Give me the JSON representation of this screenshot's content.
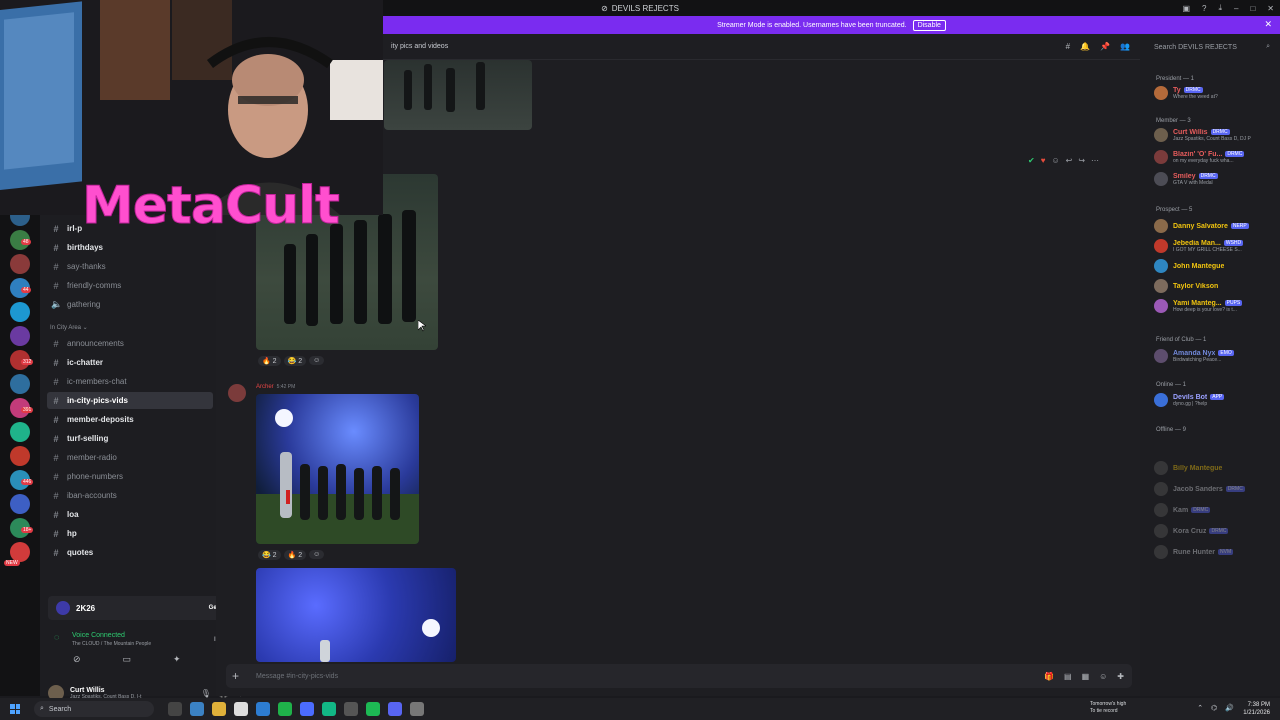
{
  "window": {
    "title": "DEVILS REJECTS"
  },
  "banner": {
    "message": "Streamer Mode is enabled. Usernames have been truncated.",
    "button": "Disable"
  },
  "rail_badges": [
    "48",
    "44",
    "312",
    "391",
    "446",
    "18+",
    "NEW"
  ],
  "sidebar": {
    "channels_top": [
      {
        "name": "irl-p",
        "bright": true
      },
      {
        "name": "birthdays",
        "bright": true
      },
      {
        "name": "say-thanks",
        "bright": false
      },
      {
        "name": "friendly-comms",
        "bright": false
      },
      {
        "name": "gathering",
        "bright": false
      }
    ],
    "category": "In City Area",
    "channels_city": [
      {
        "name": "announcements",
        "bright": false
      },
      {
        "name": "ic-chatter",
        "bright": true
      },
      {
        "name": "ic-members-chat",
        "bright": false
      },
      {
        "name": "in-city-pics-vids",
        "bright": true,
        "active": true
      },
      {
        "name": "member-deposits",
        "bright": true
      },
      {
        "name": "turf-selling",
        "bright": true
      },
      {
        "name": "member-radio",
        "bright": false
      },
      {
        "name": "phone-numbers",
        "bright": false
      },
      {
        "name": "iban-accounts",
        "bright": false
      },
      {
        "name": "loa",
        "bright": true
      },
      {
        "name": "hp",
        "bright": true
      },
      {
        "name": "quotes",
        "bright": true
      }
    ],
    "promo": {
      "logo": "2K26",
      "cta": "Get Reward"
    },
    "voice": {
      "status": "Voice Connected",
      "channel": "The CLOUD / The Mountain People"
    },
    "user": {
      "name": "Curt Willis",
      "status": "Jazz Spastiks, Count Bass D, I-t"
    }
  },
  "main": {
    "channel_partial": "ity pics and videos",
    "reactions_1": [
      {
        "emoji": "🔥",
        "count": "2"
      },
      {
        "emoji": "😂",
        "count": "2"
      }
    ],
    "message2": {
      "author": "Archer",
      "time": "5:42 PM"
    },
    "reactions_2": [
      {
        "emoji": "😂",
        "count": "2"
      },
      {
        "emoji": "🔥",
        "count": "2"
      }
    ],
    "composer_placeholder": "Message #in-city-pics-vids"
  },
  "members": {
    "search_placeholder": "Search DEVILS REJECTS",
    "groups": [
      {
        "header": "President — 1",
        "items": [
          {
            "name": "Ty",
            "tag": "DRMC",
            "color": "#e85d5d",
            "status": "Where the weed at?",
            "avatar": "#b46a3a"
          }
        ]
      },
      {
        "header": "Member — 3",
        "items": [
          {
            "name": "Curt Willis",
            "tag": "DRMC",
            "color": "#e85d5d",
            "status": "Jazz Spastiks, Count Bass D, DJ P",
            "avatar": "#6d5f4d"
          },
          {
            "name": "Blazin' 'O' Fu...",
            "tag": "DRMC",
            "color": "#e85d5d",
            "status": "on my everyday fuck wha...",
            "avatar": "#7b3b3b"
          },
          {
            "name": "Smiley",
            "tag": "DRMC",
            "color": "#e85d5d",
            "status": "GTA V with Medal",
            "avatar": "#4c4c55"
          }
        ]
      },
      {
        "header": "Prospect — 5",
        "items": [
          {
            "name": "Danny Salvatore",
            "tag": "NERP",
            "color": "#f1c40f",
            "status": "",
            "avatar": "#8a6a4a"
          },
          {
            "name": "Jebedia Man...",
            "tag": "WSHD",
            "color": "#f1c40f",
            "status": "I GOT MY GRILL CHEESE S...",
            "avatar": "#c0392b"
          },
          {
            "name": "John Mantegue",
            "tag": "",
            "color": "#f1c40f",
            "status": "",
            "avatar": "#2e86c1"
          },
          {
            "name": "Taylor Vikson",
            "tag": "",
            "color": "#f1c40f",
            "status": "",
            "avatar": "#7d6b5d"
          },
          {
            "name": "Yami Manteg...",
            "tag": "PUPS",
            "color": "#f1c40f",
            "status": "How deep is your love? is t...",
            "avatar": "#9b59b6"
          }
        ]
      },
      {
        "header": "Friend of Club — 1",
        "items": [
          {
            "name": "Amanda Nyx",
            "tag": "EMO",
            "color": "#7289da",
            "status": "Birdwatching Peace...",
            "avatar": "#5d4d6d"
          }
        ]
      },
      {
        "header": "Online — 1",
        "items": [
          {
            "name": "Devils Bot",
            "tag": "APP",
            "color": "#9aa0ff",
            "status": "dyno.gg | ?help",
            "avatar": "#3a6fd8"
          }
        ]
      },
      {
        "header": "Offline — 9",
        "items": [
          {
            "name": "Billy Mantegue",
            "tag": "",
            "color": "#f1c40f",
            "status": "",
            "avatar": "#555"
          },
          {
            "name": "Jacob Sanders",
            "tag": "DRMC",
            "color": "#c7cad0",
            "status": "",
            "avatar": "#555"
          },
          {
            "name": "Kam",
            "tag": "DRMC",
            "color": "#c7cad0",
            "status": "",
            "avatar": "#555"
          },
          {
            "name": "Kora Cruz",
            "tag": "DRMC",
            "color": "#c7cad0",
            "status": "",
            "avatar": "#555"
          },
          {
            "name": "Rune Hunter",
            "tag": "NVM",
            "color": "#c7cad0",
            "status": "",
            "avatar": "#555"
          }
        ]
      }
    ]
  },
  "overlay": {
    "logo_text": "MetaCult"
  },
  "taskbar": {
    "search": "Search",
    "weather_line1": "Tomorrow's high",
    "weather_line2": "To tie record",
    "time": "7:38 PM",
    "date": "1/21/2026"
  }
}
